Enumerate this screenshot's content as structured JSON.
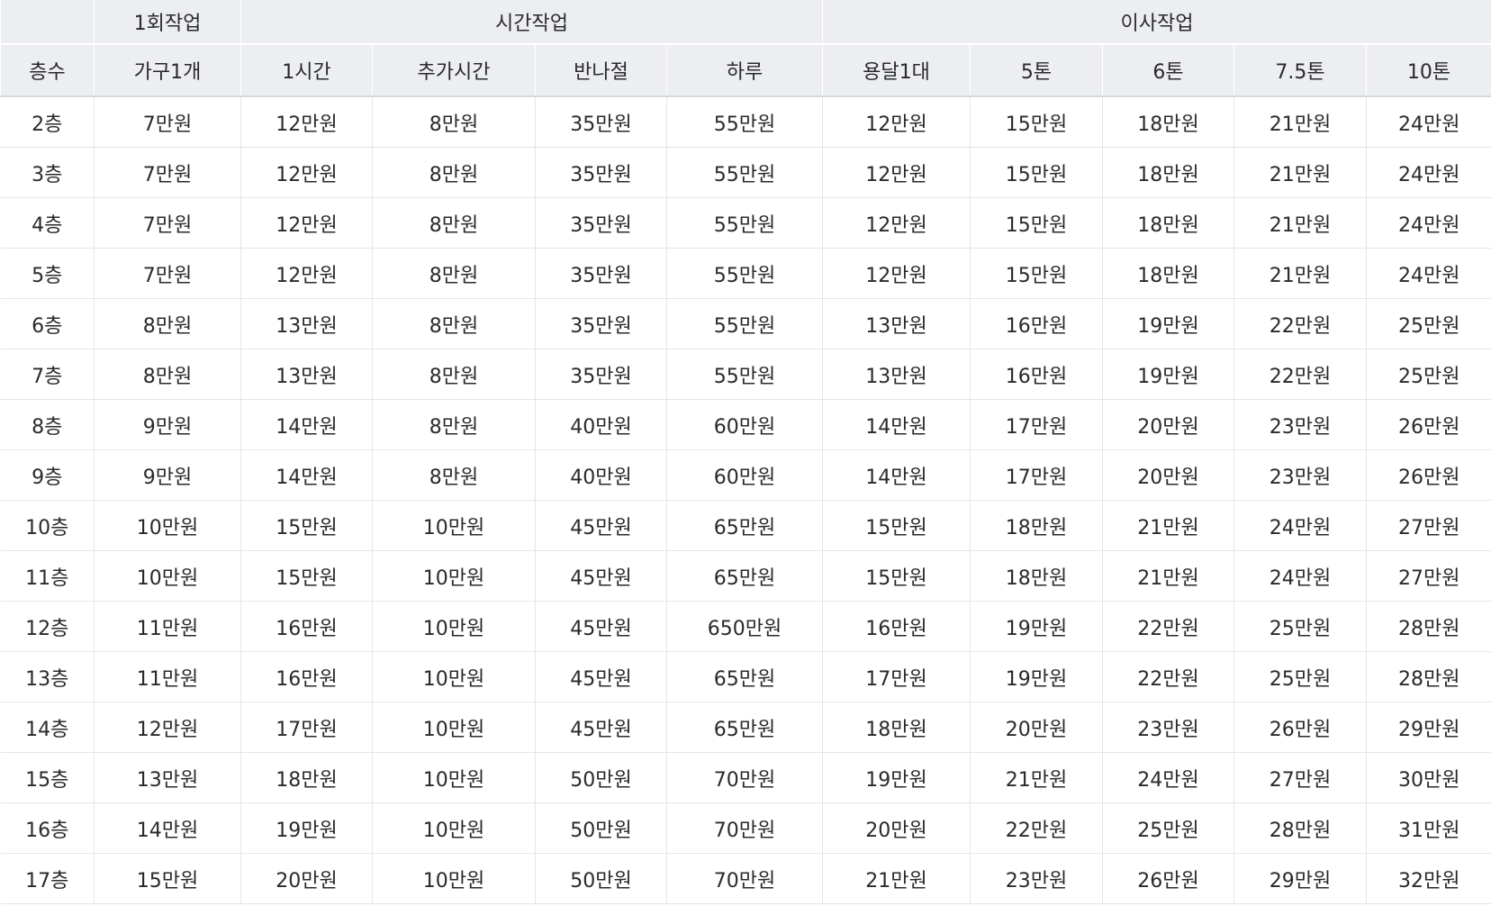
{
  "table": {
    "group_headers": [
      {
        "label": "",
        "span": 1
      },
      {
        "label": "1회작업",
        "span": 1
      },
      {
        "label": "시간작업",
        "span": 4
      },
      {
        "label": "이사작업",
        "span": 5
      }
    ],
    "columns": [
      "층수",
      "가구1개",
      "1시간",
      "추가시간",
      "반나절",
      "하루",
      "용달1대",
      "5톤",
      "6톤",
      "7.5톤",
      "10톤"
    ],
    "rows": [
      [
        "2층",
        "7만원",
        "12만원",
        "8만원",
        "35만원",
        "55만원",
        "12만원",
        "15만원",
        "18만원",
        "21만원",
        "24만원"
      ],
      [
        "3층",
        "7만원",
        "12만원",
        "8만원",
        "35만원",
        "55만원",
        "12만원",
        "15만원",
        "18만원",
        "21만원",
        "24만원"
      ],
      [
        "4층",
        "7만원",
        "12만원",
        "8만원",
        "35만원",
        "55만원",
        "12만원",
        "15만원",
        "18만원",
        "21만원",
        "24만원"
      ],
      [
        "5층",
        "7만원",
        "12만원",
        "8만원",
        "35만원",
        "55만원",
        "12만원",
        "15만원",
        "18만원",
        "21만원",
        "24만원"
      ],
      [
        "6층",
        "8만원",
        "13만원",
        "8만원",
        "35만원",
        "55만원",
        "13만원",
        "16만원",
        "19만원",
        "22만원",
        "25만원"
      ],
      [
        "7층",
        "8만원",
        "13만원",
        "8만원",
        "35만원",
        "55만원",
        "13만원",
        "16만원",
        "19만원",
        "22만원",
        "25만원"
      ],
      [
        "8층",
        "9만원",
        "14만원",
        "8만원",
        "40만원",
        "60만원",
        "14만원",
        "17만원",
        "20만원",
        "23만원",
        "26만원"
      ],
      [
        "9층",
        "9만원",
        "14만원",
        "8만원",
        "40만원",
        "60만원",
        "14만원",
        "17만원",
        "20만원",
        "23만원",
        "26만원"
      ],
      [
        "10층",
        "10만원",
        "15만원",
        "10만원",
        "45만원",
        "65만원",
        "15만원",
        "18만원",
        "21만원",
        "24만원",
        "27만원"
      ],
      [
        "11층",
        "10만원",
        "15만원",
        "10만원",
        "45만원",
        "65만원",
        "15만원",
        "18만원",
        "21만원",
        "24만원",
        "27만원"
      ],
      [
        "12층",
        "11만원",
        "16만원",
        "10만원",
        "45만원",
        "650만원",
        "16만원",
        "19만원",
        "22만원",
        "25만원",
        "28만원"
      ],
      [
        "13층",
        "11만원",
        "16만원",
        "10만원",
        "45만원",
        "65만원",
        "17만원",
        "19만원",
        "22만원",
        "25만원",
        "28만원"
      ],
      [
        "14층",
        "12만원",
        "17만원",
        "10만원",
        "45만원",
        "65만원",
        "18만원",
        "20만원",
        "23만원",
        "26만원",
        "29만원"
      ],
      [
        "15층",
        "13만원",
        "18만원",
        "10만원",
        "50만원",
        "70만원",
        "19만원",
        "21만원",
        "24만원",
        "27만원",
        "30만원"
      ],
      [
        "16층",
        "14만원",
        "19만원",
        "10만원",
        "50만원",
        "70만원",
        "20만원",
        "22만원",
        "25만원",
        "28만원",
        "31만원"
      ],
      [
        "17층",
        "15만원",
        "20만원",
        "10만원",
        "50만원",
        "70만원",
        "21만원",
        "23만원",
        "26만원",
        "29만원",
        "32만원"
      ]
    ]
  }
}
